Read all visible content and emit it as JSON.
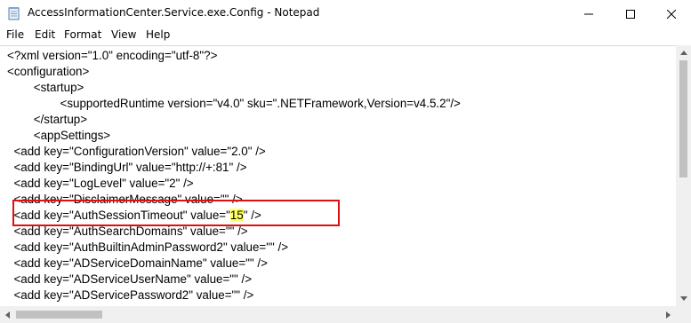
{
  "window": {
    "title": "AccessInformationCenter.Service.exe.Config - Notepad",
    "icons": {
      "app": "notepad-icon",
      "minimize": "minimize-icon",
      "maximize": "maximize-icon",
      "close": "close-icon"
    }
  },
  "menu": {
    "items": [
      "File",
      "Edit",
      "Format",
      "View",
      "Help"
    ]
  },
  "editor": {
    "lines": [
      "<?xml version=\"1.0\" encoding=\"utf-8\"?>",
      "<configuration>",
      "        <startup>",
      "                <supportedRuntime version=\"v4.0\" sku=\".NETFramework,Version=v4.5.2\"/>",
      "        </startup>",
      "        <appSettings>",
      "  <add key=\"ConfigurationVersion\" value=\"2.0\" />",
      "  <add key=\"BindingUrl\" value=\"http://+:81\" />",
      "  <add key=\"LogLevel\" value=\"2\" />",
      "  <add key=\"DisclaimerMessage\" value=\"\" />",
      "  <add key=\"AuthSearchDomains\" value=\"\" />",
      "  <add key=\"AuthBuiltinAdminPassword2\" value=\"\" />",
      "  <add key=\"ADServiceDomainName\" value=\"\" />",
      "  <add key=\"ADServiceUserName\" value=\"\" />",
      "  <add key=\"ADServicePassword2\" value=\"\" />"
    ],
    "highlighted_line": {
      "prefix": "  <add key=\"AuthSessionTimeout\" value=\"",
      "value": "15",
      "suffix": "\" />"
    },
    "highlight_color": "#ffff66",
    "annotation_color": "#e01010"
  }
}
